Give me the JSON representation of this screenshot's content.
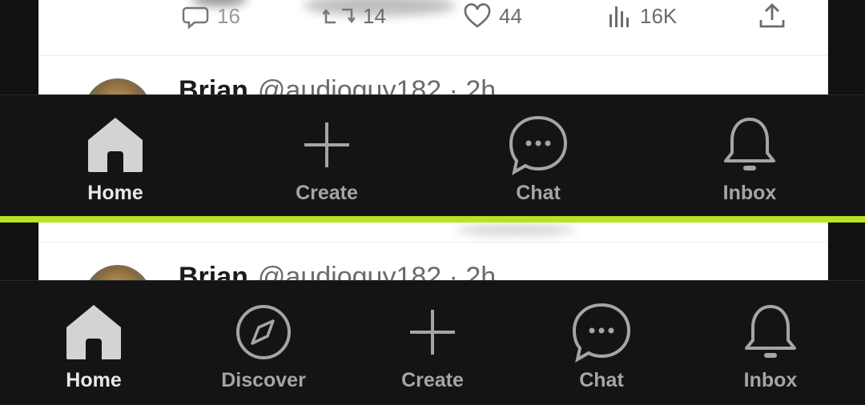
{
  "top_panel": {
    "actions": {
      "replies": "16",
      "reposts": "14",
      "likes": "44",
      "views": "16K"
    },
    "tweet": {
      "name": "Brian",
      "handle_time": "@audioguy182 · 2h"
    },
    "nav": [
      {
        "label": "Home",
        "icon": "home-icon",
        "active": true
      },
      {
        "label": "Create",
        "icon": "plus-icon",
        "active": false
      },
      {
        "label": "Chat",
        "icon": "chat-bubble-icon",
        "active": false
      },
      {
        "label": "Inbox",
        "icon": "bell-icon",
        "active": false
      }
    ]
  },
  "bottom_panel": {
    "tweet": {
      "name": "Brian",
      "handle_time": "@audioguy182 · 2h"
    },
    "nav": [
      {
        "label": "Home",
        "icon": "home-icon",
        "active": true
      },
      {
        "label": "Discover",
        "icon": "compass-icon",
        "active": false
      },
      {
        "label": "Create",
        "icon": "plus-icon",
        "active": false
      },
      {
        "label": "Chat",
        "icon": "chat-bubble-icon",
        "active": false
      },
      {
        "label": "Inbox",
        "icon": "bell-icon",
        "active": false
      }
    ]
  },
  "colors": {
    "accent_divider": "#b7e51d",
    "nav_background": "#141414",
    "active_label": "#e8e8e8",
    "inactive_label": "#a5a5a5"
  }
}
